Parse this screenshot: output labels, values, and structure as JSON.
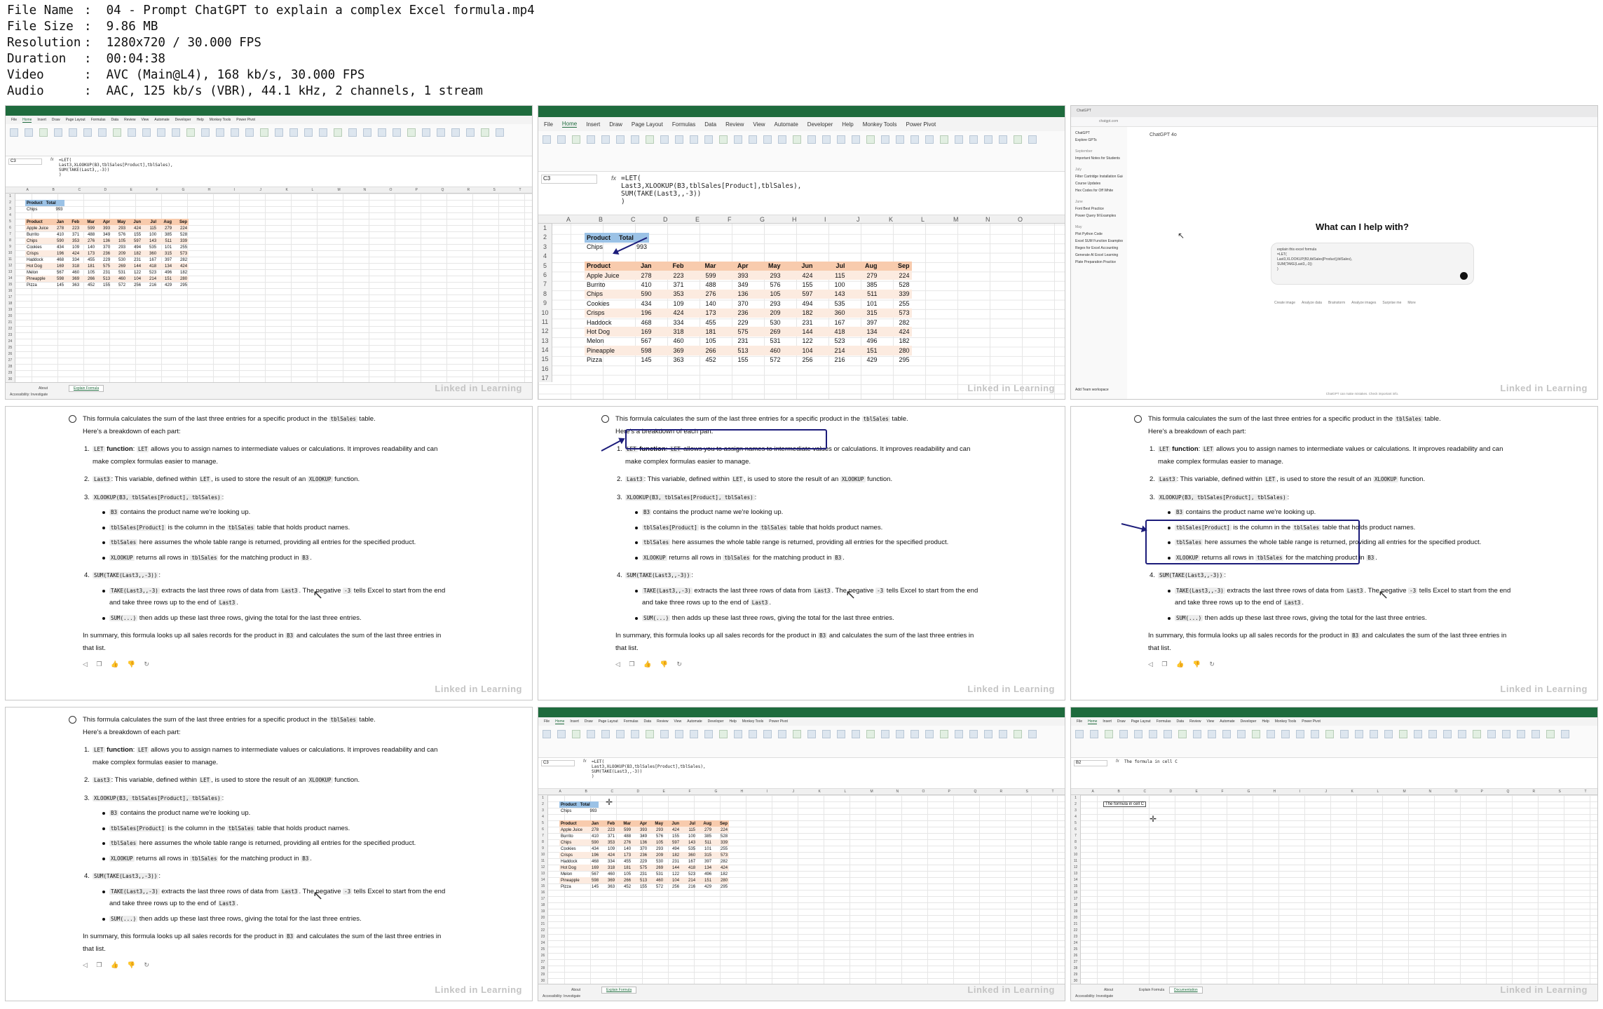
{
  "info": [
    {
      "k": "File Name",
      "v": "04 - Prompt ChatGPT to explain a complex Excel formula.mp4"
    },
    {
      "k": "File Size",
      "v": "9.86 MB"
    },
    {
      "k": "Resolution",
      "v": "1280x720 / 30.000 FPS"
    },
    {
      "k": "Duration",
      "v": "00:04:38"
    },
    {
      "k": "Video",
      "v": "AVC (Main@L4), 168 kb/s, 30.000 FPS"
    },
    {
      "k": "Audio",
      "v": "AAC, 125 kb/s (VBR), 44.1 kHz, 2 channels, 1 stream"
    }
  ],
  "watermark": "Linked in Learning",
  "excel": {
    "tabs": [
      "File",
      "Home",
      "Insert",
      "Draw",
      "Page Layout",
      "Formulas",
      "Data",
      "Review",
      "View",
      "Automate",
      "Developer",
      "Help",
      "Monkey Tools",
      "Power Pivot"
    ],
    "name_box": "C3",
    "name_box_b2": "B2",
    "fx": "fx",
    "formula": "=LET(\nLast3,XLOOKUP(B3,tblSales[Product],tblSales),\nSUM(TAKE(Last3,,-3))\n)",
    "formula_b2": "The formula in cell C",
    "columns": [
      "A",
      "B",
      "C",
      "D",
      "E",
      "F",
      "G",
      "H",
      "I",
      "J",
      "K",
      "L",
      "M",
      "N",
      "O"
    ],
    "sheets": [
      "About",
      "Explain Formula",
      "Documentation"
    ],
    "status": "Accessibility: Investigate",
    "totals": {
      "headers": [
        "Product",
        "Total"
      ],
      "product": "Chips",
      "total": "993"
    },
    "sales_headers": [
      "Product",
      "Jan",
      "Feb",
      "Mar",
      "Apr",
      "May",
      "Jun",
      "Jul",
      "Aug",
      "Sep"
    ],
    "sales": [
      [
        "Apple Juice",
        "278",
        "223",
        "599",
        "393",
        "293",
        "424",
        "115",
        "279",
        "224"
      ],
      [
        "Burrito",
        "410",
        "371",
        "488",
        "349",
        "576",
        "155",
        "100",
        "385",
        "528"
      ],
      [
        "Chips",
        "590",
        "353",
        "276",
        "136",
        "105",
        "597",
        "143",
        "511",
        "339"
      ],
      [
        "Cookies",
        "434",
        "109",
        "140",
        "370",
        "293",
        "494",
        "535",
        "101",
        "255"
      ],
      [
        "Crisps",
        "196",
        "424",
        "173",
        "236",
        "209",
        "182",
        "360",
        "315",
        "573"
      ],
      [
        "Haddock",
        "468",
        "334",
        "455",
        "229",
        "530",
        "231",
        "167",
        "397",
        "282"
      ],
      [
        "Hot Dog",
        "169",
        "318",
        "181",
        "575",
        "269",
        "144",
        "418",
        "134",
        "424"
      ],
      [
        "Melon",
        "567",
        "460",
        "105",
        "231",
        "531",
        "122",
        "523",
        "496",
        "182"
      ],
      [
        "Pineapple",
        "598",
        "369",
        "266",
        "513",
        "460",
        "104",
        "214",
        "151",
        "280"
      ],
      [
        "Pizza",
        "145",
        "363",
        "452",
        "155",
        "572",
        "256",
        "216",
        "429",
        "295"
      ]
    ]
  },
  "chatgpt": {
    "url": "chatgpt.com",
    "model": "ChatGPT 4o",
    "sidebar": [
      "ChatGPT",
      "Explore GPTs"
    ],
    "sidebar_heading_1": "September",
    "sidebar_items_1": [
      "Important Notes for Students"
    ],
    "sidebar_heading_2": "July",
    "sidebar_items_2": [
      "Filter Cartridge Installation Guide",
      "Course Updates",
      "Hex Codes for Off White"
    ],
    "sidebar_heading_3": "June",
    "sidebar_items_3": [
      "Font Best Practice",
      "Power Query M Examples"
    ],
    "sidebar_heading_4": "May",
    "sidebar_items_4": [
      "Plot Python Code",
      "Excel SUM Function Examples",
      "Regex for Excel Accounting",
      "Generate AI Excel Learning",
      "Plate Preparation Practice"
    ],
    "help": "What can I help with?",
    "prompt_lines": [
      "explain this excel formula",
      "=LET(",
      "Last3,XLOOKUP(B3,tblSales[Product],tblSales),",
      "SUM(TAKE(Last3,,-3))",
      ")"
    ],
    "chips": [
      "Create image",
      "Analyze data",
      "Brainstorm",
      "Analyze images",
      "Surprise me",
      "More"
    ],
    "upgrade": "Add Team workspace",
    "footer": "ChatGPT can make mistakes. Check important info."
  },
  "explain": {
    "intro_a": "This formula calculates the sum of the last three entries for a specific product in the ",
    "intro_code": "tblSales",
    "intro_b": " table.",
    "breakdown_a": "Here's a breakdown of each part:",
    "i1_num": "1.",
    "i1_code": "LET",
    "i1_bold": " function",
    "i1_code2": "LET",
    "i1_text": " allows you to assign names to intermediate values or calculations. It improves readability and can make complex formulas easier to manage.",
    "i2_num": "2.",
    "i2_code": "Last3",
    "i2_text_a": ": This variable, defined within ",
    "i2_code2": "LET",
    "i2_text_b": ", is used to store the result of an ",
    "i2_code3": "XLOOKUP",
    "i2_text_c": " function.",
    "i3_num": "3.",
    "i3_code": "XLOOKUP(B3, tblSales[Product], tblSales)",
    "i3_b1_code": "B3",
    "i3_b1_text": " contains the product name we're looking up.",
    "i3_b2_code": "tblSales[Product]",
    "i3_b2_text_a": " is the column in the ",
    "i3_b2_code2": "tblSales",
    "i3_b2_text_b": " table that holds product names.",
    "i3_b3_code": "tblSales",
    "i3_b3_text": " here assumes the whole table range is returned, providing all entries for the specified product.",
    "i3_b4_code": "XLOOKUP",
    "i3_b4_text_a": " returns all rows in ",
    "i3_b4_code2": "tblSales",
    "i3_b4_text_b": " for the matching product in ",
    "i3_b4_code3": "B3",
    "i4_num": "4.",
    "i4_code": "SUM(TAKE(Last3,,-3))",
    "i4_b1_code": "TAKE(Last3,,-3)",
    "i4_b1_text_a": " extracts the last three rows of data from ",
    "i4_b1_code2": "Last3",
    "i4_b1_text_b": ". The negative ",
    "i4_b1_code3": "-3",
    "i4_b1_text_c": " tells Excel to start from the end and take three rows up to the end of ",
    "i4_b1_code4": "Last3",
    "i4_b2_code": "SUM(...)",
    "i4_b2_text": " then adds up these last three rows, giving the total for the last three entries.",
    "summary_a": "In summary, this formula looks up all sales records for the product in ",
    "summary_code": "B3",
    "summary_b": " and calculates the sum of the last three entries in that list.",
    "actions": "◁ ❐ 👍 👎 ↻",
    "period": "."
  }
}
